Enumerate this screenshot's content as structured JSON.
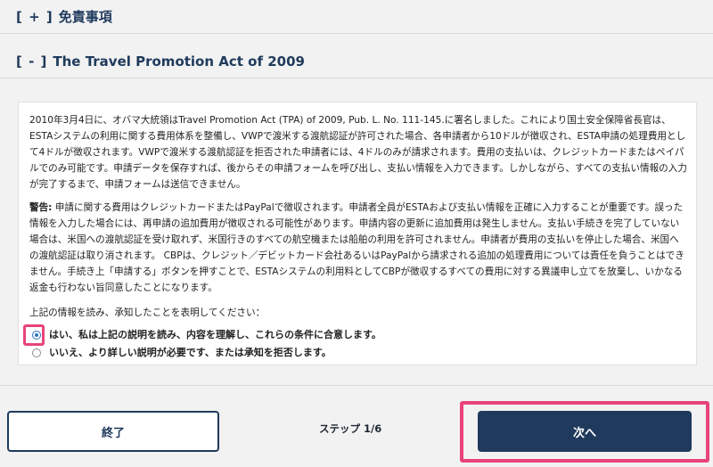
{
  "sections": {
    "disclaimer": {
      "toggle": "[ + ]",
      "title": "免責事項"
    },
    "tpa": {
      "toggle": "[ - ]",
      "title": "The Travel Promotion Act of 2009"
    }
  },
  "content": {
    "paragraph1": "2010年3月4日に、オバマ大統領はTravel Promotion Act (TPA) of 2009, Pub. L. No. 111-145.に署名しました。これにより国土安全保障省長官は、ESTAシステムの利用に関する費用体系を整備し、VWPで渡米する渡航認証が許可された場合、各申請者から10ドルが徴収され、ESTA申請の処理費用として4ドルが徴収されます。VWPで渡米する渡航認証を拒否された申請者には、4ドルのみが請求されます。費用の支払いは、クレジットカードまたはペイパルでのみ可能です。申請データを保存すれば、後からその申請フォームを呼び出し、支払い情報を入力できます。しかしながら、すべての支払い情報の入力が完了するまで、申請フォームは送信できません。",
    "warning_label": "警告:",
    "warning_text": " 申請に関する費用はクレジットカードまたはPayPalで徴収されます。申請者全員がESTAおよび支払い情報を正確に入力することが重要です。誤った情報を入力した場合には、再申請の追加費用が徴収される可能性があります。申請内容の更新に追加費用は発生しません。支払い手続きを完了していない場合は、米国への渡航認証を受け取れず、米国行きのすべての航空機または船舶の利用を許可されません。申請者が費用の支払いを停止した場合、米国への渡航認証は取り消されます。 CBPは、クレジット／デビットカード会社あるいはPayPalから請求される追加の処理費用については責任を負うことはできません。手続き上「申請する」ボタンを押すことで、ESTAシステムの利用料としてCBPが徴収するすべての費用に対する異議申し立てを放棄し、いかなる返金も行わない旨同意したことになります。",
    "consent_prompt": "上記の情報を読み、承知したことを表明してください：",
    "options": [
      {
        "label": "はい、私は上記の説明を読み、内容を理解し、これらの条件に合意します。",
        "selected": true
      },
      {
        "label": "いいえ、より詳しい説明が必要です、または承知を拒否します。",
        "selected": false
      }
    ]
  },
  "footer": {
    "exit_label": "終了",
    "step_text": "ステップ 1/6",
    "next_label": "次へ"
  },
  "colors": {
    "accent": "#1f3a5c",
    "highlight": "#e8437a",
    "radio_selected": "#2e6fc2"
  }
}
